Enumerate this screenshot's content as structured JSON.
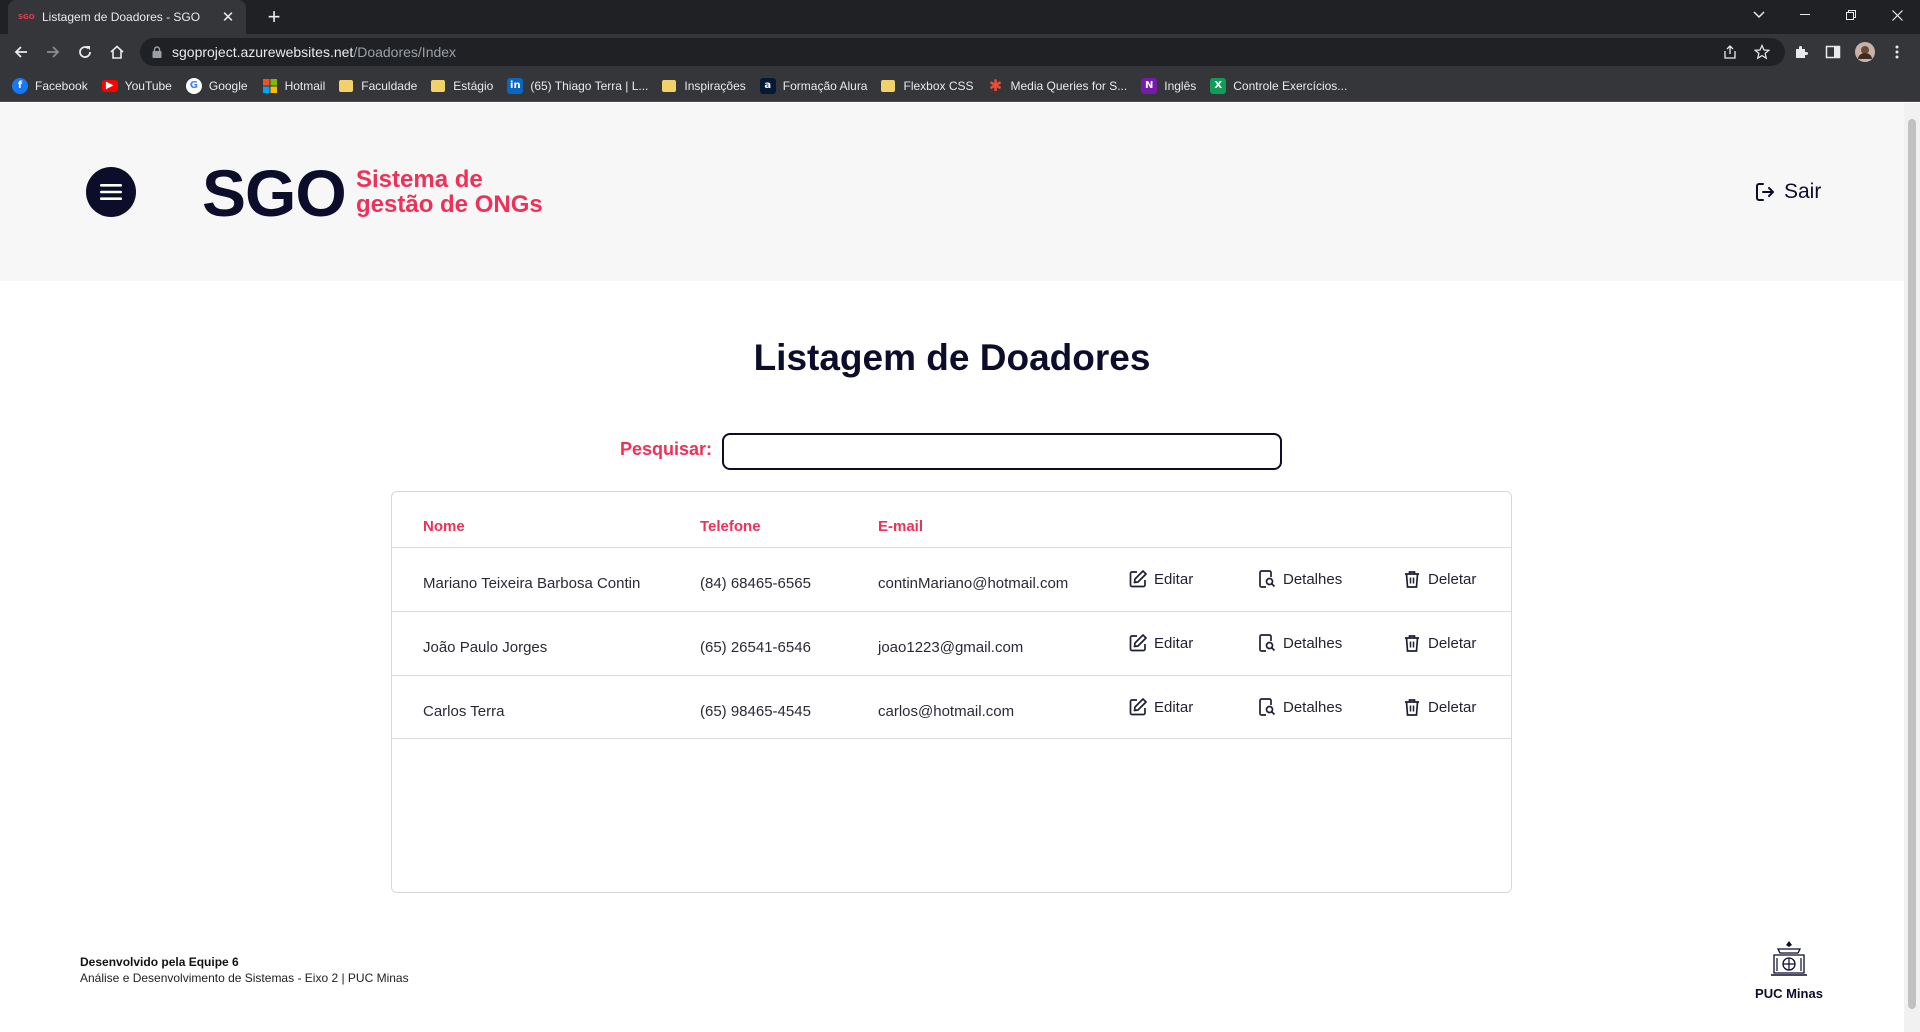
{
  "browser": {
    "tab_title": "Listagem de Doadores - SGO",
    "tab_favicon": "SGO",
    "url_host": "sgoproject.azurewebsites.net",
    "url_path": "/Doadores/Index",
    "bookmarks": [
      {
        "label": "Facebook",
        "icon": "facebook-icon",
        "color": "#1877f2"
      },
      {
        "label": "YouTube",
        "icon": "youtube-icon",
        "color": "#ff0000"
      },
      {
        "label": "Google",
        "icon": "google-icon",
        "color": "#ffffff"
      },
      {
        "label": "Hotmail",
        "icon": "microsoft-icon",
        "color": "#f25022"
      },
      {
        "label": "Faculdade",
        "icon": "folder-icon",
        "color": "#f2d16b"
      },
      {
        "label": "Estágio",
        "icon": "folder-icon",
        "color": "#f2d16b"
      },
      {
        "label": "(65) Thiago Terra | L...",
        "icon": "linkedin-icon",
        "color": "#0a66c2"
      },
      {
        "label": "Inspirações",
        "icon": "folder-icon",
        "color": "#f2d16b"
      },
      {
        "label": "Formação Alura",
        "icon": "alura-icon",
        "color": "#051933"
      },
      {
        "label": "Flexbox CSS",
        "icon": "folder-icon",
        "color": "#f2d16b"
      },
      {
        "label": "Media Queries for S...",
        "icon": "asterisk-icon",
        "color": "#e94d35"
      },
      {
        "label": "Inglês",
        "icon": "onenote-icon",
        "color": "#7719aa"
      },
      {
        "label": "Controle Exercícios...",
        "icon": "sheets-icon",
        "color": "#0f9d58"
      }
    ]
  },
  "header": {
    "brand": "SGO",
    "tagline_line1": "Sistema de",
    "tagline_line2": "gestão de ONGs",
    "logout_label": "Sair"
  },
  "main": {
    "title": "Listagem de Doadores",
    "search_label": "Pesquisar:",
    "search_value": "",
    "columns": [
      "Nome",
      "Telefone",
      "E-mail"
    ],
    "actions": {
      "edit": "Editar",
      "details": "Detalhes",
      "delete": "Deletar"
    },
    "rows": [
      {
        "nome": "Mariano Teixeira Barbosa Contin",
        "telefone": "(84) 68465-6565",
        "email": "continMariano@hotmail.com"
      },
      {
        "nome": "João Paulo Jorges",
        "telefone": "(65) 26541-6546",
        "email": "joao1223@gmail.com"
      },
      {
        "nome": "Carlos Terra",
        "telefone": "(65) 98465-4545",
        "email": "carlos@hotmail.com"
      }
    ]
  },
  "footer": {
    "team": "Desenvolvido pela Equipe 6",
    "course": "Análise e Desenvolvimento de Sistemas - Eixo 2 | PUC Minas",
    "logo_text": "PUC Minas"
  },
  "colors": {
    "accent": "#ee3158",
    "navy": "#0b0d2a"
  }
}
